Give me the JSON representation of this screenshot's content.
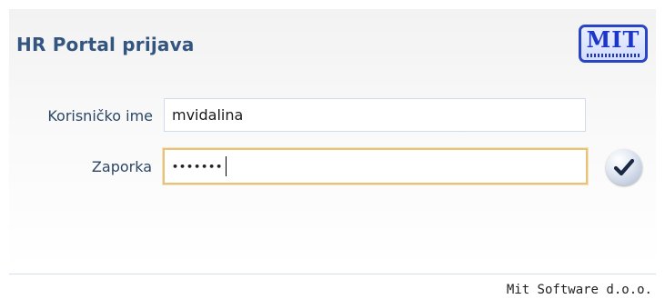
{
  "header": {
    "title": "HR Portal prijava",
    "logo_text": "MIT"
  },
  "form": {
    "username": {
      "label": "Korisničko ime",
      "value": "mvidalina"
    },
    "password": {
      "label": "Zaporka",
      "masked_value": "•••••••"
    },
    "submit": {
      "icon": "checkmark-icon"
    }
  },
  "footer": {
    "company": "Mit Software d.o.o."
  },
  "colors": {
    "title": "#33557f",
    "label": "#2c4666",
    "focus_border": "#e6c27a",
    "logo_blue": "#1c36c8"
  }
}
